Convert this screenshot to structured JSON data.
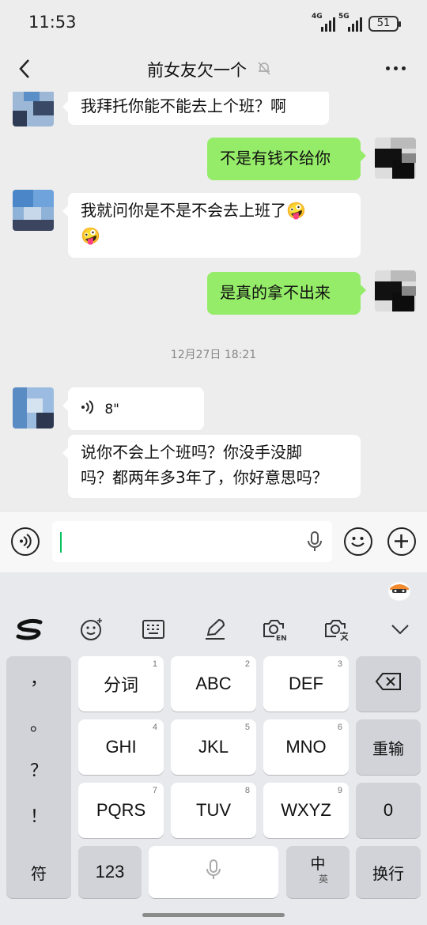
{
  "status_bar": {
    "time": "11:53",
    "signal_1": "4G",
    "signal_2": "5G",
    "battery": "51"
  },
  "header": {
    "title": "前女友欠一个",
    "back_icon": "chevron-left-icon",
    "mute_icon": "bell-off-icon",
    "more_icon": "more-dots-icon"
  },
  "messages": [
    {
      "side": "in",
      "text": "我拜托你能不能去上个班？啊"
    },
    {
      "side": "out",
      "text": "不是有钱不给你"
    },
    {
      "side": "in",
      "text": "我就问你是不是不会去上班了🤪",
      "text2": "🤪"
    },
    {
      "side": "out",
      "text": "是真的拿不出来"
    },
    {
      "side": "in",
      "type": "voice",
      "duration": "8\""
    },
    {
      "side": "in",
      "text": "说你不会上个班吗？你没手没脚",
      "text2": "吗？都两年多3年了，你好意思吗？"
    }
  ],
  "timestamp": "12月27日 18:21",
  "input_bar": {
    "voice_icon": "voice-input-icon",
    "mic_icon": "microphone-icon",
    "emoji_icon": "emoji-icon",
    "plus_icon": "plus-icon",
    "value": ""
  },
  "keyboard": {
    "toolbar": [
      "swipe-logo-icon",
      "emoji-icon",
      "keyboard-layout-icon",
      "handwriting-pen-icon",
      "camera-translate-en-icon",
      "camera-translate-text-icon",
      "collapse-icon"
    ],
    "symbols": [
      "，",
      "。",
      "？",
      "！"
    ],
    "rows": [
      [
        {
          "label": "分词",
          "num": "1"
        },
        {
          "label": "ABC",
          "num": "2"
        },
        {
          "label": "DEF",
          "num": "3"
        }
      ],
      [
        {
          "label": "GHI",
          "num": "4"
        },
        {
          "label": "JKL",
          "num": "5"
        },
        {
          "label": "MNO",
          "num": "6"
        }
      ],
      [
        {
          "label": "PQRS",
          "num": "7"
        },
        {
          "label": "TUV",
          "num": "8"
        },
        {
          "label": "WXYZ",
          "num": "9"
        }
      ]
    ],
    "right_keys": {
      "delete_icon": "backspace-icon",
      "reinput": "重输",
      "zero": "0"
    },
    "bottom": {
      "symbols": "符",
      "numbers": "123",
      "space_icon": "microphone-icon",
      "lang_main": "中",
      "lang_sub": "英",
      "enter": "换行"
    }
  },
  "colors": {
    "out_bubble": "#95ec69",
    "caret": "#07c160",
    "chat_bg": "#ededed"
  }
}
